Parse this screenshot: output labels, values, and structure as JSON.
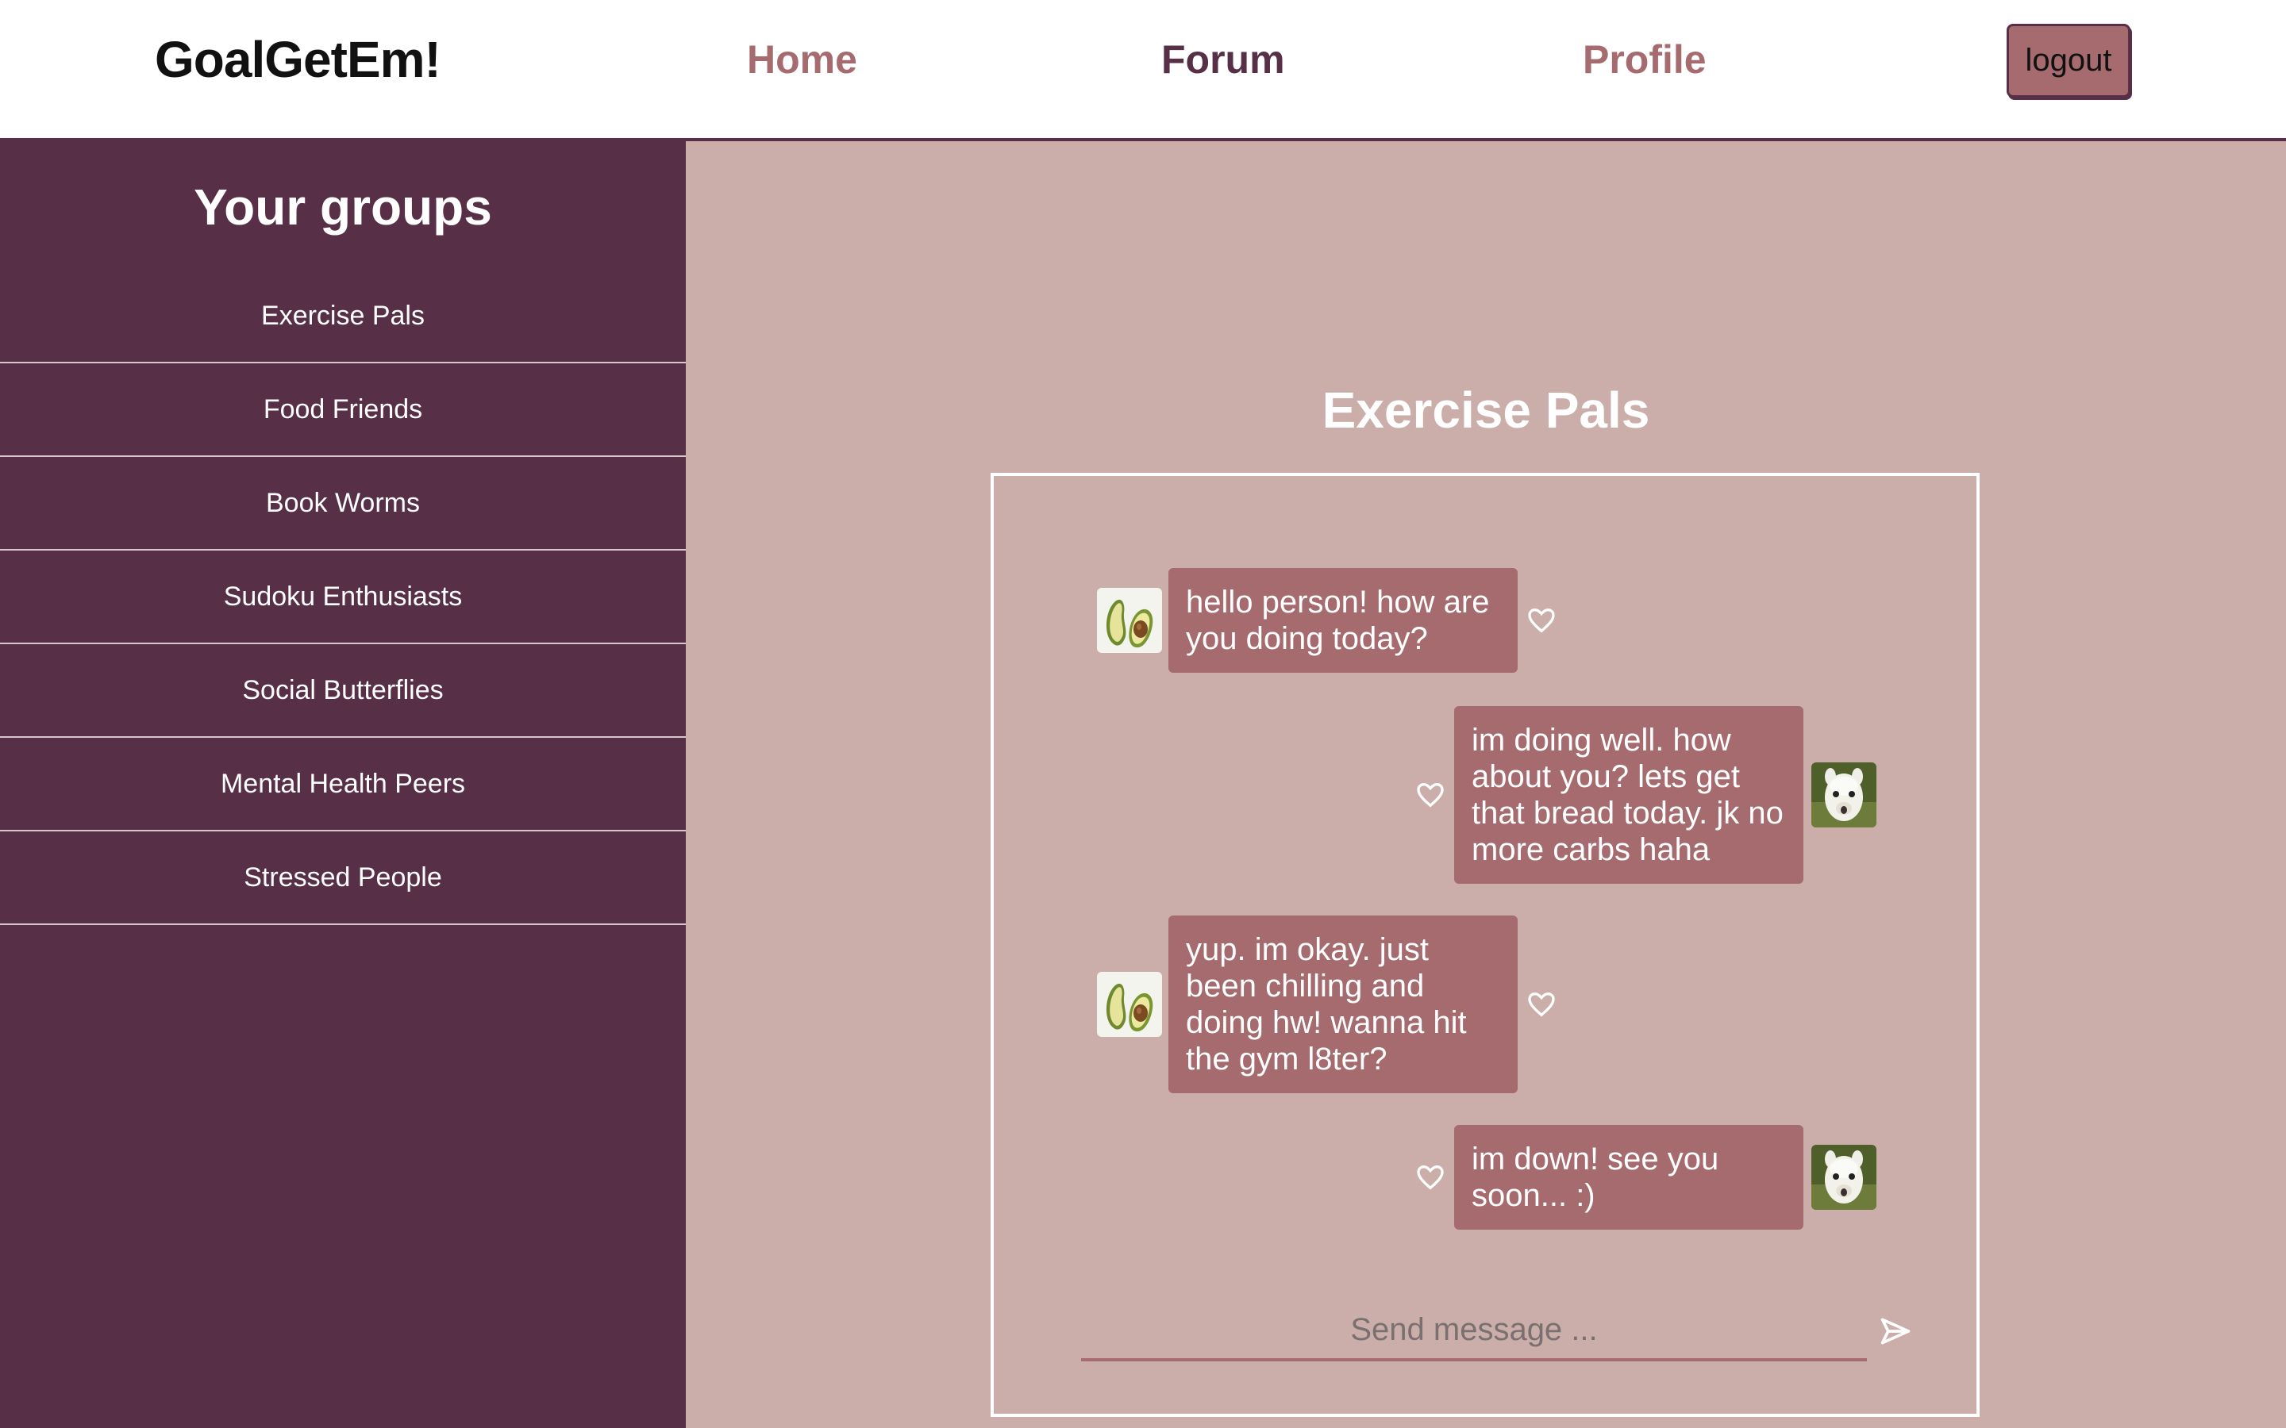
{
  "header": {
    "brand": "GoalGetEm!",
    "nav": {
      "home": "Home",
      "forum": "Forum",
      "profile": "Profile"
    },
    "logout": "logout"
  },
  "sidebar": {
    "title": "Your groups",
    "groups": [
      "Exercise Pals",
      "Food Friends",
      "Book Worms",
      "Sudoku Enthusiasts",
      "Social Butterflies",
      "Mental Health Peers",
      "Stressed People"
    ]
  },
  "chat": {
    "title": "Exercise Pals",
    "messages": [
      {
        "side": "left",
        "avatar": "avocado-icon",
        "text": "hello person! how are you doing today?"
      },
      {
        "side": "right",
        "avatar": "alpaca-icon",
        "text": "im doing well. how about you? lets get that bread today. jk no more carbs haha"
      },
      {
        "side": "left",
        "avatar": "avocado-icon",
        "text": "yup. im okay. just been chilling and doing hw! wanna hit the gym l8ter?"
      },
      {
        "side": "right",
        "avatar": "alpaca-icon",
        "text": "im down! see you soon... :)"
      }
    ],
    "input_placeholder": "Send message ...",
    "input_value": ""
  },
  "colors": {
    "primary": "#573047",
    "accent": "#a66b6e",
    "background": "#cbaeaa",
    "text_light": "#ffffff"
  }
}
